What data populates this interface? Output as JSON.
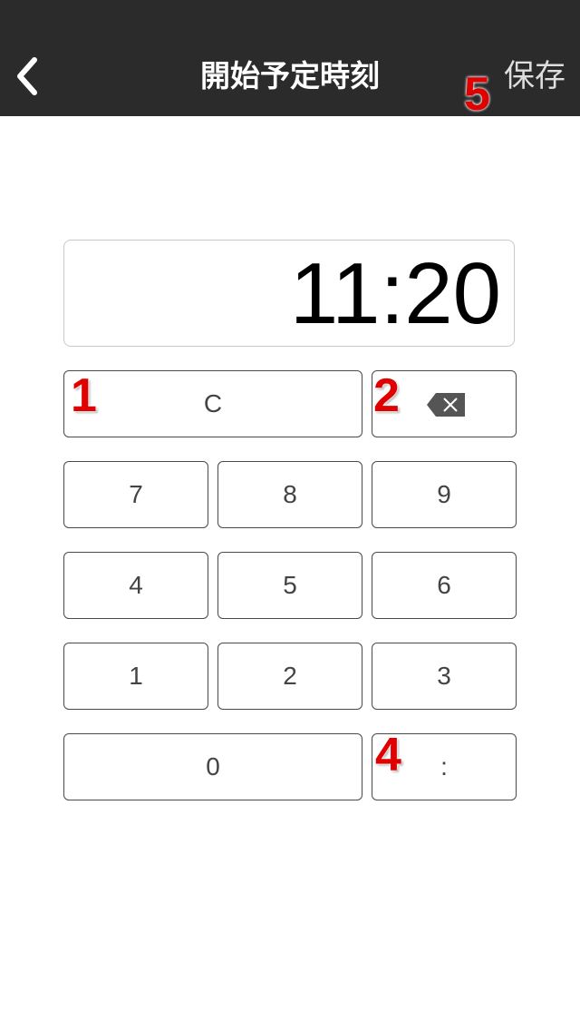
{
  "header": {
    "title": "開始予定時刻",
    "save_label": "保存",
    "back_icon": "chevron-left-icon"
  },
  "display": {
    "value": "11:20"
  },
  "keypad": {
    "clear": "C",
    "backspace_icon": "backspace-icon",
    "k7": "7",
    "k8": "8",
    "k9": "9",
    "k4": "4",
    "k5": "5",
    "k6": "6",
    "k1": "1",
    "k2": "2",
    "k3": "3",
    "k0": "0",
    "colon": ":"
  },
  "annotations": {
    "a1": "1",
    "a2": "2",
    "a4": "4",
    "a5": "5"
  },
  "colors": {
    "navbar": "#2b2b2b",
    "badge": "#e00000"
  }
}
